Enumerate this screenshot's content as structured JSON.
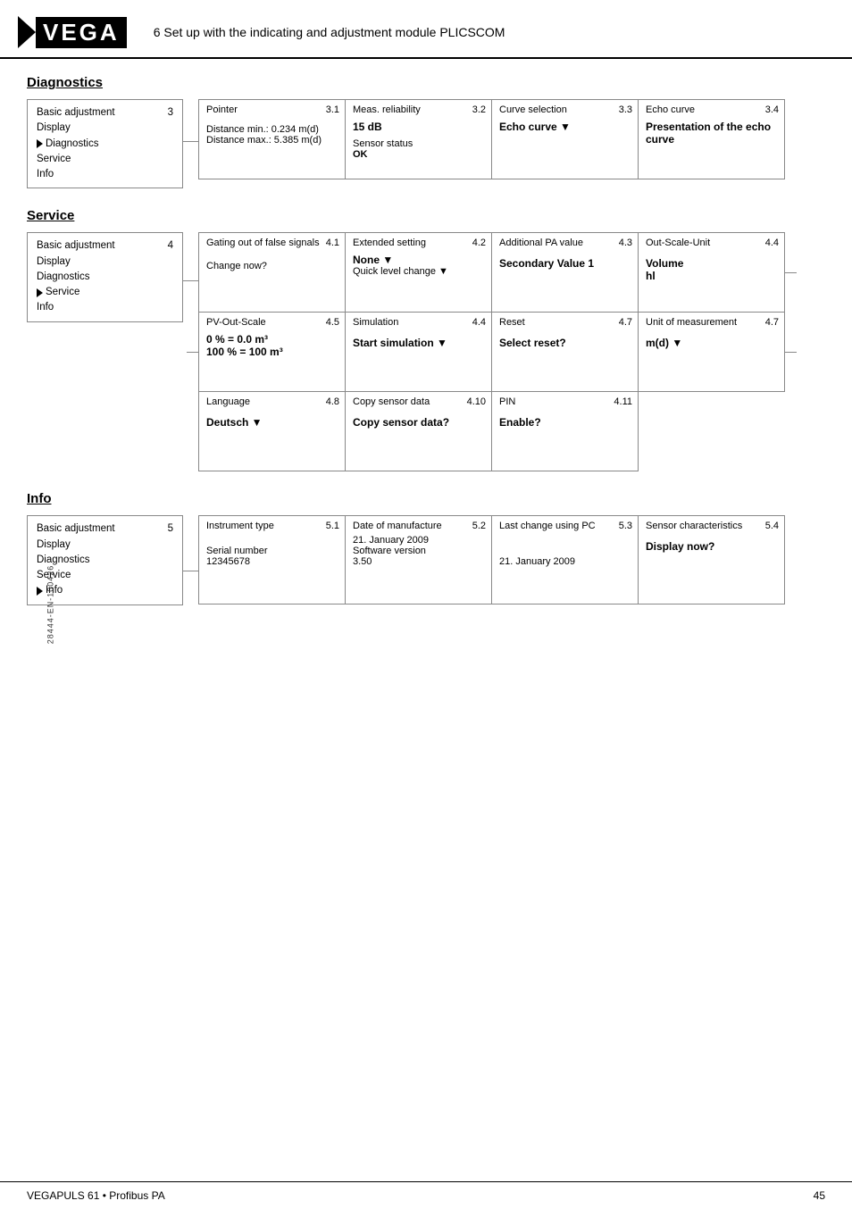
{
  "header": {
    "logo_text": "VEGA",
    "title": "6   Set up with the indicating and adjustment module PLICSCOM"
  },
  "diagnostics": {
    "section_title": "Diagnostics",
    "menu": {
      "number": "3",
      "items": [
        {
          "label": "Basic adjustment",
          "active": false
        },
        {
          "label": "Display",
          "active": false
        },
        {
          "label": "Diagnostics",
          "active": true
        },
        {
          "label": "Service",
          "active": false
        },
        {
          "label": "Info",
          "active": false
        }
      ]
    },
    "boxes": [
      {
        "number": "3.1",
        "label": "Pointer",
        "value": "",
        "lines": [
          "Distance min.: 0.234 m(d)",
          "Distance max.: 5.385 m(d)"
        ]
      },
      {
        "number": "3.2",
        "label": "Meas. reliability",
        "value": "15 dB",
        "lines": [
          "Sensor status",
          "OK"
        ]
      },
      {
        "number": "3.3",
        "label": "Curve selection",
        "value": "Echo curve ▼",
        "lines": []
      },
      {
        "number": "3.4",
        "label": "Echo curve",
        "value": "Presentation of the echo curve",
        "lines": []
      }
    ]
  },
  "service": {
    "section_title": "Service",
    "menu": {
      "number": "4",
      "items": [
        {
          "label": "Basic adjustment",
          "active": false
        },
        {
          "label": "Display",
          "active": false
        },
        {
          "label": "Diagnostics",
          "active": false
        },
        {
          "label": "Service",
          "active": true
        },
        {
          "label": "Info",
          "active": false
        }
      ]
    },
    "rows": [
      [
        {
          "number": "4.1",
          "label": "Gating out of false signals",
          "value": "",
          "lines": [
            "Change now?"
          ],
          "bold_lines": []
        },
        {
          "number": "4.2",
          "label": "Extended setting",
          "value": "",
          "lines": [
            "None ▼",
            "Quick level change ▼"
          ],
          "bold_lines": [
            0
          ]
        },
        {
          "number": "4.3",
          "label": "Additional PA value",
          "value": "",
          "lines": [
            "Secondary Value 1"
          ],
          "bold_lines": [
            0
          ]
        },
        {
          "number": "4.4",
          "label": "Out-Scale-Unit",
          "value": "",
          "lines": [
            "Volume",
            "hl"
          ],
          "bold_lines": [
            0,
            1
          ],
          "has_right_line": true
        }
      ],
      [
        {
          "number": "4.5",
          "label": "PV-Out-Scale",
          "value": "",
          "lines": [
            "0 % = 0.0 m³",
            "100 % = 100 m³"
          ],
          "bold_lines": [
            0,
            1
          ],
          "has_left_line": true
        },
        {
          "number": "4.4",
          "label": "Simulation",
          "value": "",
          "lines": [
            "Start simulation ▼"
          ],
          "bold_lines": [
            0
          ]
        },
        {
          "number": "4.7",
          "label": "Reset",
          "value": "",
          "lines": [
            "Select reset?"
          ],
          "bold_lines": [
            0
          ]
        },
        {
          "number": "4.7",
          "label": "Unit of measurement",
          "value": "",
          "lines": [
            "m(d) ▼"
          ],
          "bold_lines": [
            0
          ],
          "has_right_line": true
        }
      ],
      [
        {
          "number": "4.8",
          "label": "Language",
          "value": "",
          "lines": [
            "Deutsch ▼"
          ],
          "bold_lines": [
            0
          ]
        },
        {
          "number": "4.10",
          "label": "Copy sensor data",
          "value": "",
          "lines": [
            "Copy sensor data?"
          ],
          "bold_lines": [
            0
          ]
        },
        {
          "number": "4.11",
          "label": "PIN",
          "value": "",
          "lines": [
            "Enable?"
          ],
          "bold_lines": [
            0
          ]
        }
      ]
    ]
  },
  "info": {
    "section_title": "Info",
    "menu": {
      "number": "5",
      "items": [
        {
          "label": "Basic adjustment",
          "active": false
        },
        {
          "label": "Display",
          "active": false
        },
        {
          "label": "Diagnostics",
          "active": false
        },
        {
          "label": "Service",
          "active": false
        },
        {
          "label": "Info",
          "active": true
        }
      ]
    },
    "boxes": [
      {
        "number": "5.1",
        "label": "Instrument type",
        "lines": [
          "",
          "Serial number",
          "12345678"
        ]
      },
      {
        "number": "5.2",
        "label": "Date of manufacture",
        "lines": [
          "21. January 2009",
          "Software version",
          "3.50"
        ]
      },
      {
        "number": "5.3",
        "label": "Last change using PC",
        "lines": [
          "",
          "",
          "21. January 2009"
        ]
      },
      {
        "number": "5.4",
        "label": "Sensor characteristics",
        "lines": [
          "",
          "Display now?"
        ],
        "bold_lines": [
          1
        ]
      }
    ]
  },
  "footer": {
    "left": "VEGAPULS 61 • Profibus PA",
    "right": "45",
    "side_label": "28444-EN-100426"
  }
}
